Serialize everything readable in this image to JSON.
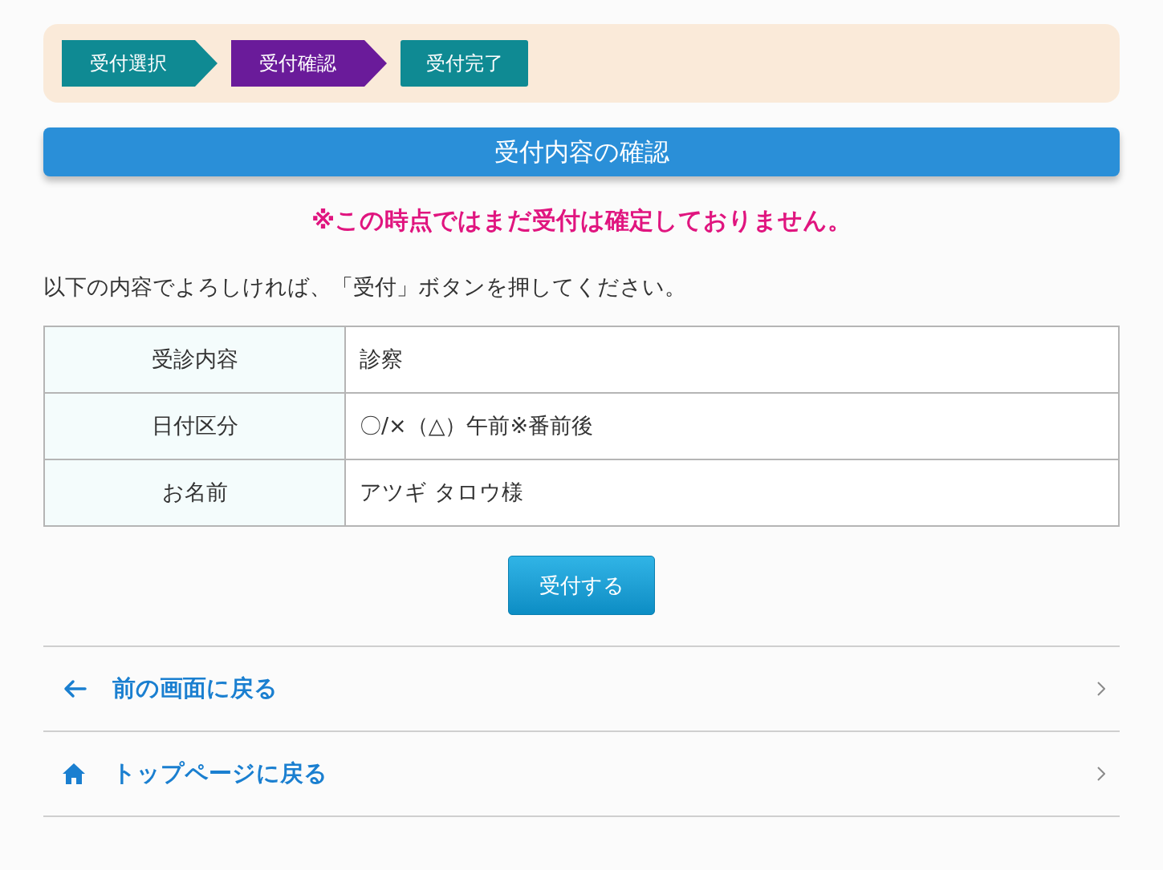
{
  "steps": [
    {
      "label": "受付選択",
      "selected": false
    },
    {
      "label": "受付確認",
      "selected": true
    },
    {
      "label": "受付完了",
      "selected": false
    }
  ],
  "heading": "受付内容の確認",
  "warning": "※この時点ではまだ受付は確定しておりません。",
  "instruction": "以下の内容でよろしければ、「受付」ボタンを押してください。",
  "table": {
    "rows": [
      {
        "label": "受診内容",
        "value": "診察"
      },
      {
        "label": "日付区分",
        "value": "〇/×（△）午前※番前後"
      },
      {
        "label": "お名前",
        "value": "アツギ タロウ様"
      }
    ]
  },
  "submit_button": "受付する",
  "nav_links": [
    {
      "kind": "back",
      "label": "前の画面に戻る"
    },
    {
      "kind": "home",
      "label": "トップページに戻る"
    }
  ]
}
